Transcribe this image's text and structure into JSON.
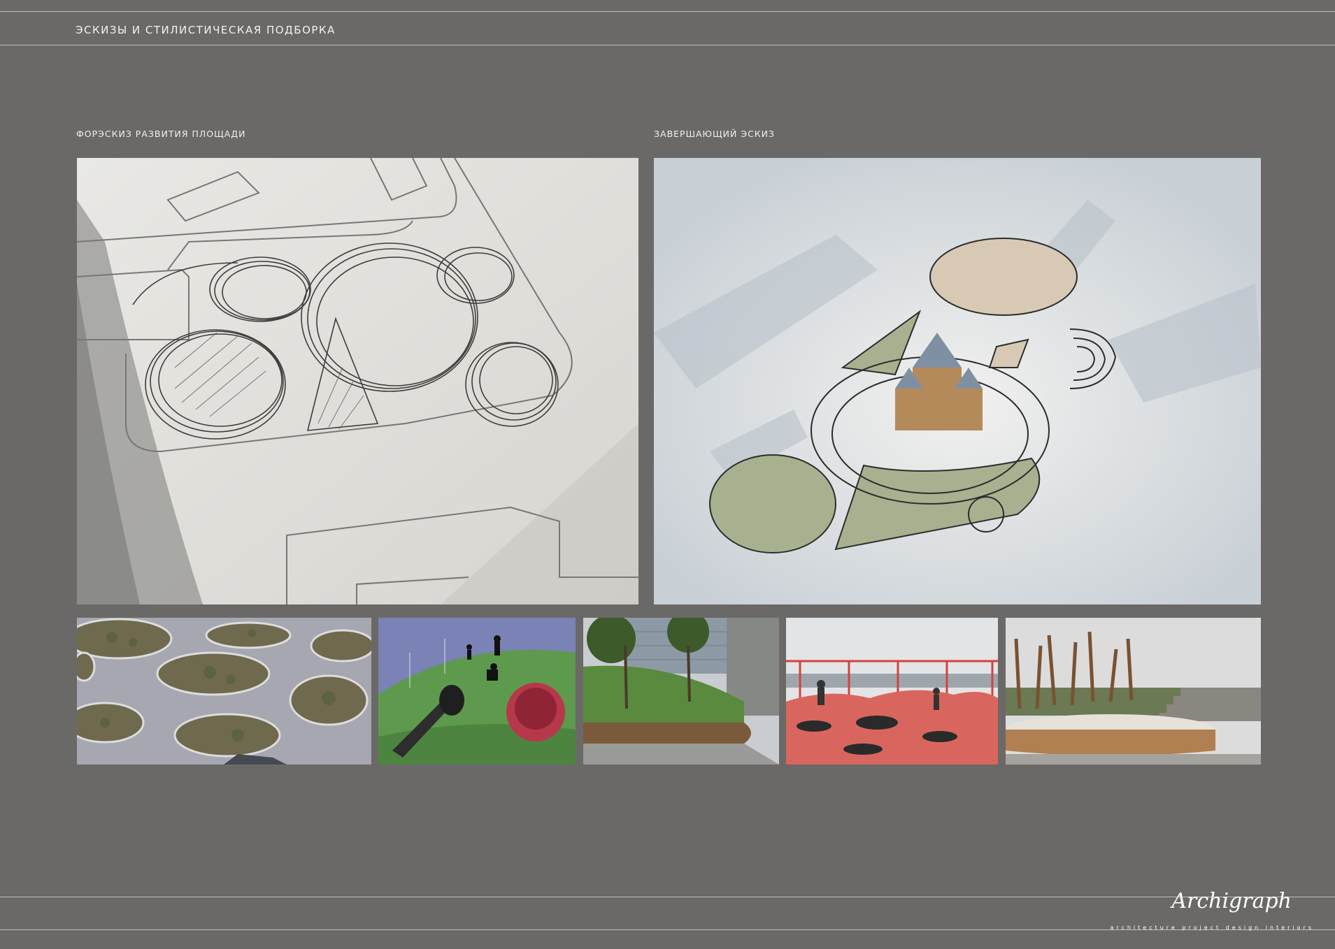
{
  "header": {
    "title": "ЭСКИЗЫ И СТИЛИСТИЧЕСКАЯ ПОДБОРКА"
  },
  "sketches": {
    "left_caption": "ФОРЭСКИЗ РАЗВИТИЯ ПЛОЩАДИ",
    "right_caption": "ЗАВЕРШАЮЩИЙ ЭСКИЗ"
  },
  "references": [
    {
      "subject": "aerial-planters"
    },
    {
      "subject": "climbing-hill-slide"
    },
    {
      "subject": "circular-bench-lawn"
    },
    {
      "subject": "trampoline-playground"
    },
    {
      "subject": "timber-poles-amphitheatre"
    }
  ],
  "footer": {
    "logo_text": "Archigraph",
    "logo_tagline": "architecture project design interiors"
  }
}
